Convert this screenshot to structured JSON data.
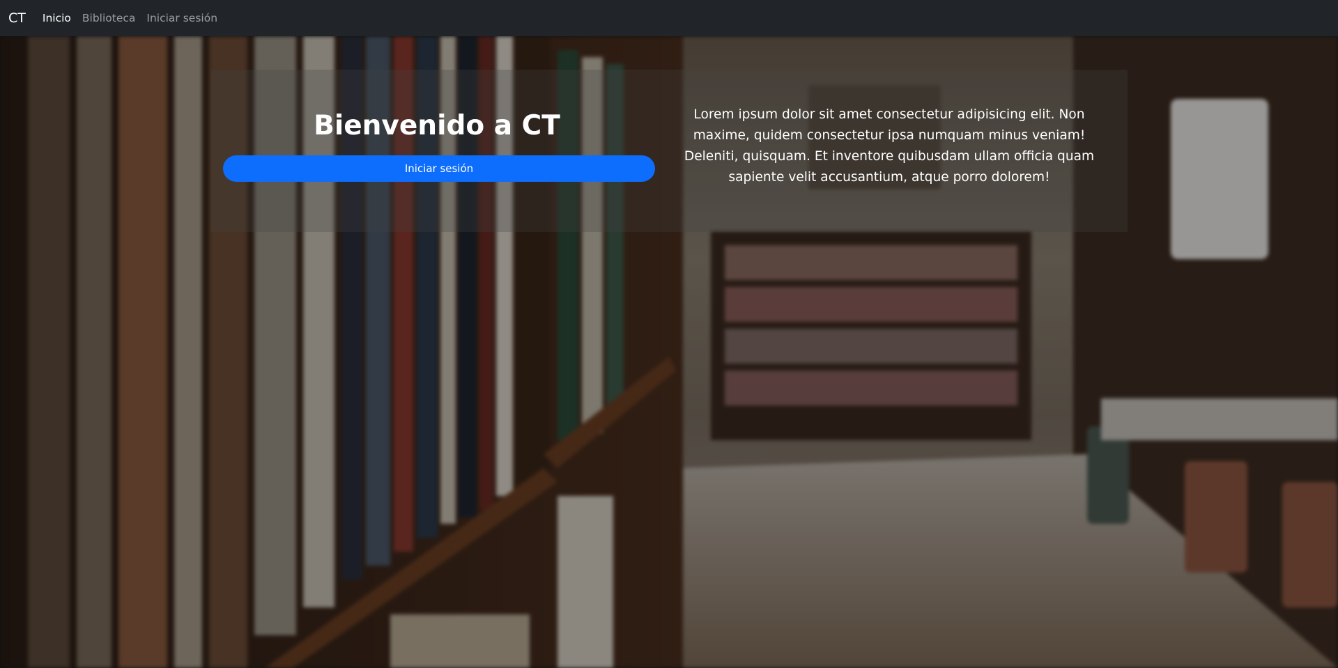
{
  "navbar": {
    "brand": "CT",
    "links": [
      {
        "label": "Inicio",
        "active": true
      },
      {
        "label": "Biblioteca",
        "active": false
      },
      {
        "label": "Iniciar sesión",
        "active": false
      }
    ]
  },
  "hero": {
    "title": "Bienvenido a CT",
    "login_button": "Iniciar sesión",
    "description": "Lorem ipsum dolor sit amet consectetur adipisicing elit. Non maxime, quidem consectetur ipsa numquam minus veniam! Deleniti, quisquam. Et inventore quibusdam ullam officia quam sapiente velit accusantium, atque porro dolorem!"
  },
  "colors": {
    "navbar_bg": "#212529",
    "primary": "#0d6efd"
  }
}
